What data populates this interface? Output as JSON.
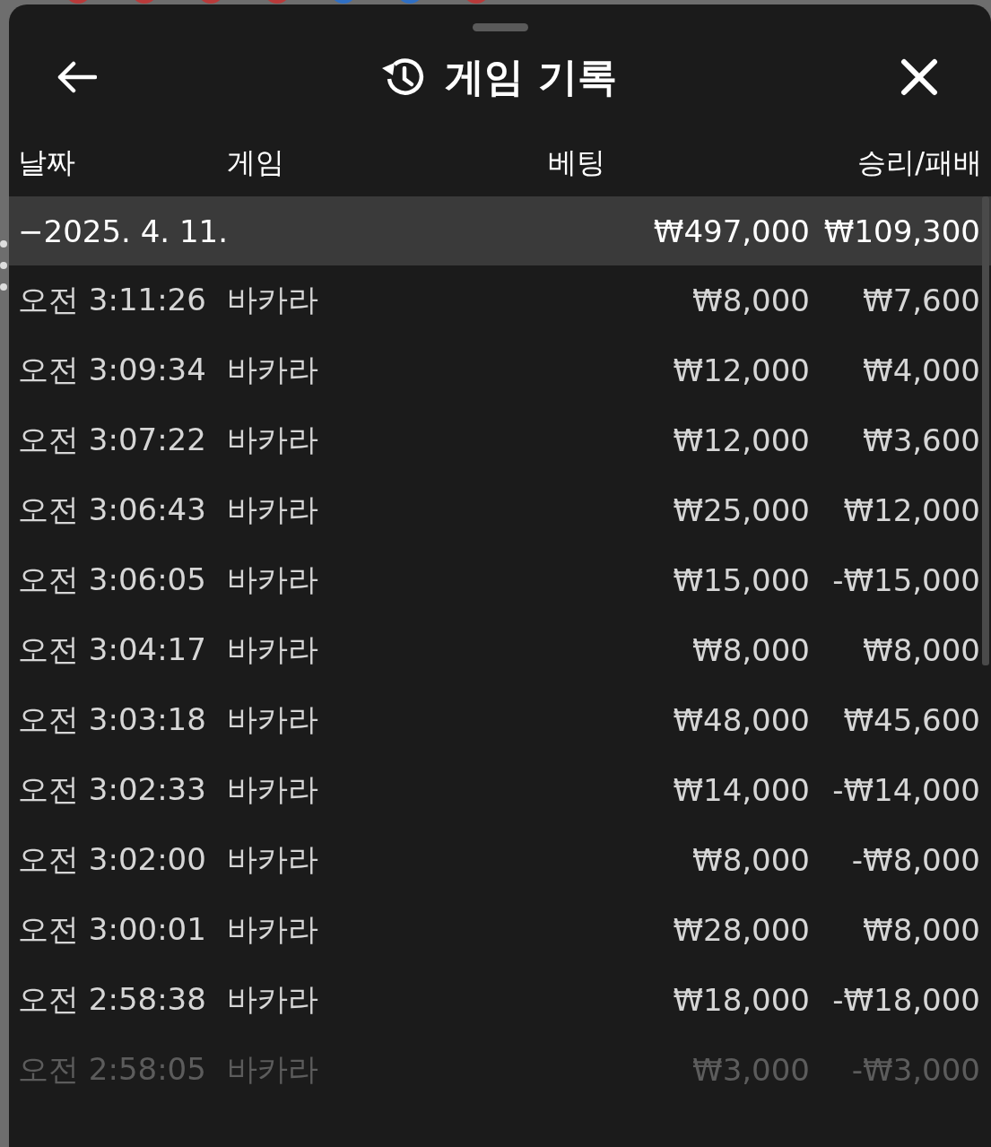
{
  "background": {
    "beads": [
      {
        "color": "#b83a3a"
      },
      {
        "color": "#b83a3a"
      },
      {
        "color": "#b83a3a"
      },
      {
        "color": "#b83a3a"
      },
      {
        "color": "#2f6fc4"
      },
      {
        "color": "#2f6fc4"
      },
      {
        "color": "#b83a3a"
      }
    ]
  },
  "header": {
    "title": "게임 기록"
  },
  "table": {
    "columns": [
      "날짜",
      "게임",
      "베팅",
      "승리/패배"
    ],
    "group": {
      "toggle": "−",
      "date": "2025. 4. 11.",
      "bet": "₩497,000",
      "result": "₩109,300"
    },
    "rows": [
      {
        "time": "오전 3:11:26",
        "game": "바카라",
        "bet": "₩8,000",
        "result": "₩7,600",
        "dimmed": false
      },
      {
        "time": "오전 3:09:34",
        "game": "바카라",
        "bet": "₩12,000",
        "result": "₩4,000",
        "dimmed": false
      },
      {
        "time": "오전 3:07:22",
        "game": "바카라",
        "bet": "₩12,000",
        "result": "₩3,600",
        "dimmed": false
      },
      {
        "time": "오전 3:06:43",
        "game": "바카라",
        "bet": "₩25,000",
        "result": "₩12,000",
        "dimmed": false
      },
      {
        "time": "오전 3:06:05",
        "game": "바카라",
        "bet": "₩15,000",
        "result": "-₩15,000",
        "dimmed": false
      },
      {
        "time": "오전 3:04:17",
        "game": "바카라",
        "bet": "₩8,000",
        "result": "₩8,000",
        "dimmed": false
      },
      {
        "time": "오전 3:03:18",
        "game": "바카라",
        "bet": "₩48,000",
        "result": "₩45,600",
        "dimmed": false
      },
      {
        "time": "오전 3:02:33",
        "game": "바카라",
        "bet": "₩14,000",
        "result": "-₩14,000",
        "dimmed": false
      },
      {
        "time": "오전 3:02:00",
        "game": "바카라",
        "bet": "₩8,000",
        "result": "-₩8,000",
        "dimmed": false
      },
      {
        "time": "오전 3:00:01",
        "game": "바카라",
        "bet": "₩28,000",
        "result": "₩8,000",
        "dimmed": false
      },
      {
        "time": "오전 2:58:38",
        "game": "바카라",
        "bet": "₩18,000",
        "result": "-₩18,000",
        "dimmed": false
      },
      {
        "time": "오전 2:58:05",
        "game": "바카라",
        "bet": "₩3,000",
        "result": "-₩3,000",
        "dimmed": true
      }
    ]
  }
}
